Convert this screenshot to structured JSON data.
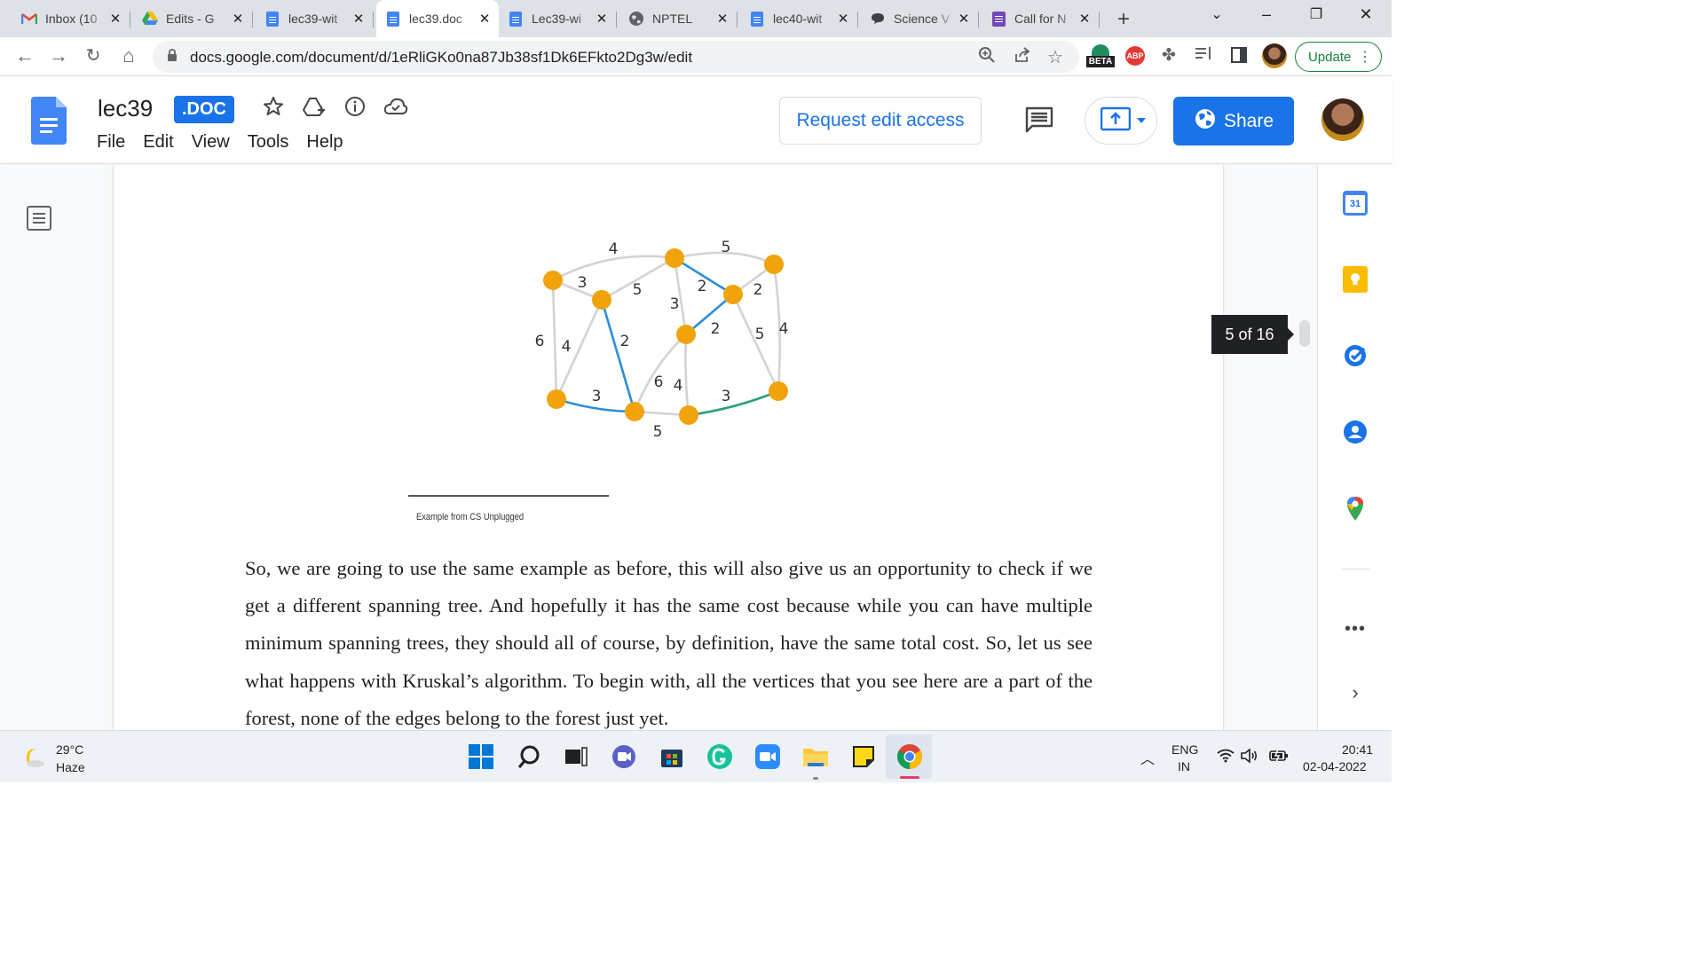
{
  "browser": {
    "tabs": [
      {
        "title": "Inbox (10",
        "icon": "gmail-icon",
        "active": false
      },
      {
        "title": "Edits - G",
        "icon": "drive-icon",
        "active": false
      },
      {
        "title": "lec39-wit",
        "icon": "docs-icon",
        "active": false
      },
      {
        "title": "lec39.doc",
        "icon": "docs-icon",
        "active": true
      },
      {
        "title": "Lec39-wi",
        "icon": "docs-icon",
        "active": false
      },
      {
        "title": "NPTEL",
        "icon": "globe-icon",
        "active": false
      },
      {
        "title": "lec40-wit",
        "icon": "docs-icon",
        "active": false
      },
      {
        "title": "Science V",
        "icon": "chat-icon",
        "active": false
      },
      {
        "title": "Call for N",
        "icon": "forms-icon",
        "active": false
      }
    ],
    "url": "docs.google.com/document/d/1eRliGKo0na87Jb38sf1Dk6EFkto2Dg3w/edit",
    "extension_beta_label": "BETA",
    "extension_abp_label": "ABP",
    "update_label": "Update"
  },
  "doc": {
    "title": "lec39",
    "badge": ".DOC",
    "menu": [
      "File",
      "Edit",
      "View",
      "Tools",
      "Help"
    ],
    "request_edit_label": "Request edit access",
    "share_label": "Share",
    "page_indicator": "5 of 16",
    "figure_caption": "Example from CS Unplugged",
    "body_text": "So, we are going to use the same example as before, this will also give us an opportunity to check if we get a different spanning tree. And hopefully it has the same cost because while you can have multiple minimum spanning trees, they should all of course, by definition, have the same total cost. So, let us see what happens with Kruskal’s algorithm. To begin with, all the vertices that you see here are a part of the forest, none of the edges belong to the forest just yet."
  },
  "graph": {
    "colors": {
      "node": "#f0a30a",
      "edge_default": "#d3d3d3",
      "edge_blue": "#2b8fd8",
      "edge_green": "#2aa07a"
    },
    "edge_weights": [
      "4",
      "5",
      "3",
      "5",
      "3",
      "2",
      "2",
      "6",
      "4",
      "2",
      "2",
      "5",
      "4",
      "3",
      "6",
      "4",
      "3",
      "5"
    ]
  },
  "calendar_day": "31",
  "taskbar": {
    "weather_temp": "29°C",
    "weather_desc": "Haze",
    "lang_line1": "ENG",
    "lang_line2": "IN",
    "time": "20:41",
    "date": "02-04-2022"
  }
}
